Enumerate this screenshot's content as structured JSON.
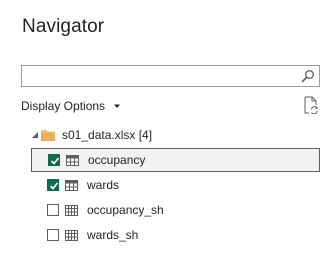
{
  "navigator": {
    "title": "Navigator",
    "search": {
      "value": "",
      "placeholder": ""
    },
    "display_options_label": "Display Options",
    "tree": {
      "root": {
        "label": "s01_data.xlsx [4]",
        "expanded": true
      },
      "items": [
        {
          "label": "occupancy",
          "checked": true,
          "selected": true,
          "icon": "table-icon"
        },
        {
          "label": "wards",
          "checked": true,
          "selected": false,
          "icon": "table-icon"
        },
        {
          "label": "occupancy_sh",
          "checked": false,
          "selected": false,
          "icon": "sheet-icon"
        },
        {
          "label": "wards_sh",
          "checked": false,
          "selected": false,
          "icon": "sheet-icon"
        }
      ]
    }
  }
}
